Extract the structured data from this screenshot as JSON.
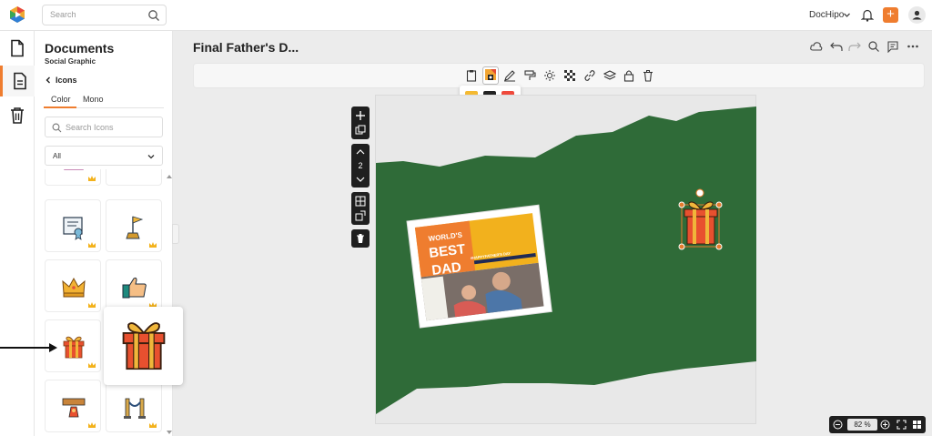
{
  "topbar": {
    "search_placeholder": "Search",
    "brand": "DocHipo",
    "plus": "+"
  },
  "panel": {
    "title": "Documents",
    "subtitle": "Social Graphic",
    "back_label": "Icons",
    "tabs": [
      "Color",
      "Mono"
    ],
    "active_tab": "Color",
    "icon_search_placeholder": "Search Icons",
    "filter_value": "All",
    "tiles": [
      {
        "icon": "partial-icon-left"
      },
      {
        "icon": "partial-icon-right"
      },
      {
        "icon": "certificate-scroll-icon"
      },
      {
        "icon": "trophy-flag-icon"
      },
      {
        "icon": "crown-icon"
      },
      {
        "icon": "thumbs-up-icon"
      },
      {
        "icon": "gift-box-icon"
      },
      {
        "icon": "hidden-icon"
      },
      {
        "icon": "congrats-sign-icon"
      },
      {
        "icon": "rope-barrier-icon"
      }
    ]
  },
  "document": {
    "title": "Final Father's D...",
    "page_number": "2"
  },
  "canvas": {
    "card_text_1": "WORLD'S",
    "card_text_2": "BEST",
    "card_text_3": "DAD",
    "card_small": "#HAPPYFATHER'S DAY"
  },
  "swatches": [
    "#f4b931",
    "#222222",
    "#ef4a3c"
  ],
  "zoom": {
    "value": "82",
    "unit": "%"
  },
  "colors": {
    "accent": "#ef7d2f",
    "canvas_green": "#2f6b38",
    "dark": "#1f1f1f"
  }
}
